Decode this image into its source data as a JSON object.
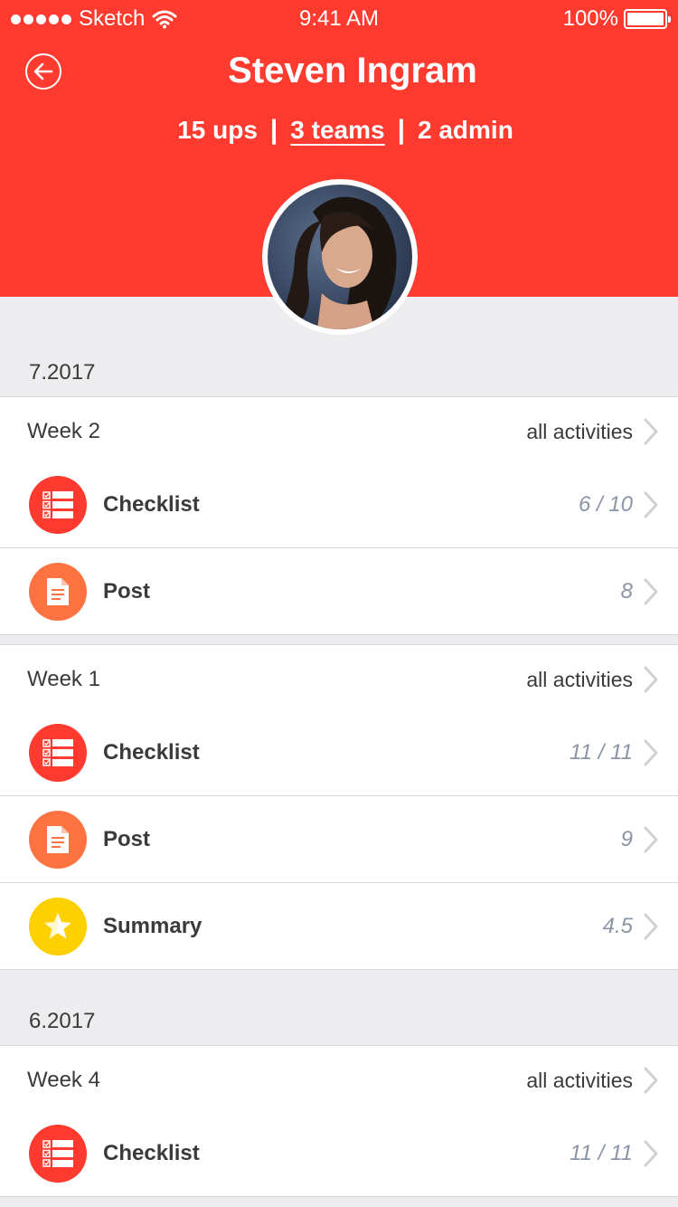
{
  "status_bar": {
    "carrier": "Sketch",
    "time": "9:41 AM",
    "battery": "100%"
  },
  "header": {
    "title": "Steven Ingram",
    "stats": {
      "ups": "15 ups",
      "teams": "3 teams",
      "admin": "2 admin"
    },
    "background_color": "#ff3b30"
  },
  "sections": [
    {
      "label": "7.2017",
      "weeks": [
        {
          "label": "Week 2",
          "link": "all activities",
          "activities": [
            {
              "label": "Checklist",
              "value": "6 / 10",
              "icon": "checklist-icon",
              "color": "#ff3b30"
            },
            {
              "label": "Post",
              "value": "8",
              "icon": "document-icon",
              "color": "#ff7342"
            }
          ]
        },
        {
          "label": "Week 1",
          "link": "all activities",
          "activities": [
            {
              "label": "Checklist",
              "value": "11 / 11",
              "icon": "checklist-icon",
              "color": "#ff3b30"
            },
            {
              "label": "Post",
              "value": "9",
              "icon": "document-icon",
              "color": "#ff7342"
            },
            {
              "label": "Summary",
              "value": "4.5",
              "icon": "star-icon",
              "color": "#ffd000"
            }
          ]
        }
      ]
    },
    {
      "label": "6.2017",
      "weeks": [
        {
          "label": "Week 4",
          "link": "all activities",
          "activities": [
            {
              "label": "Checklist",
              "value": "11 / 11",
              "icon": "checklist-icon",
              "color": "#ff3b30"
            }
          ]
        }
      ]
    }
  ]
}
